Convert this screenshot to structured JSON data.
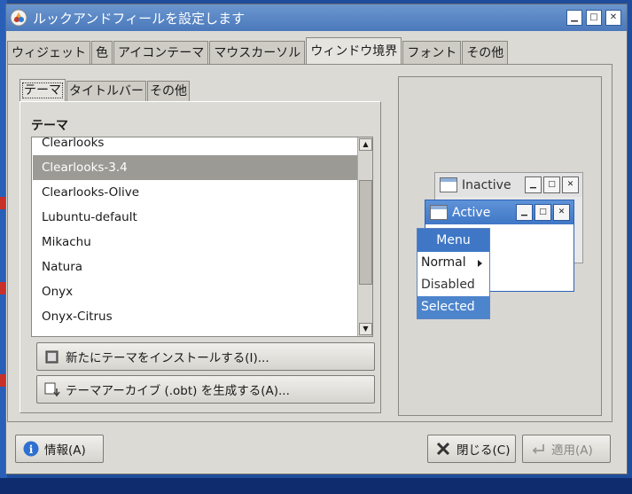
{
  "window": {
    "title": "ルックアンドフィールを設定します"
  },
  "tabs": [
    {
      "label": "ウィジェット"
    },
    {
      "label": "色"
    },
    {
      "label": "アイコンテーマ"
    },
    {
      "label": "マウスカーソル"
    },
    {
      "label": "ウィンドウ境界",
      "active": true
    },
    {
      "label": "フォント"
    },
    {
      "label": "その他"
    }
  ],
  "subtabs": [
    {
      "label": "テーマ",
      "active": true
    },
    {
      "label": "タイトルバー"
    },
    {
      "label": "その他"
    }
  ],
  "theme_section": {
    "label": "テーマ",
    "themes": [
      "Clearlooks",
      "Clearlooks-3.4",
      "Clearlooks-Olive",
      "Lubuntu-default",
      "Mikachu",
      "Natura",
      "Onyx",
      "Onyx-Citrus"
    ],
    "selected": "Clearlooks-3.4",
    "install_button": "新たにテーマをインストールする(I)...",
    "archive_button": "テーマアーカイブ (.obt) を生成する(A)..."
  },
  "preview": {
    "inactive_title": "Inactive",
    "active_title": "Active",
    "menu": {
      "title": "Menu",
      "items": [
        "Normal",
        "Disabled",
        "Selected"
      ]
    }
  },
  "footer": {
    "about_button": "情報(A)",
    "close_button": "閉じる(C)",
    "apply_button": "適用(A)"
  },
  "colors": {
    "titlebar": "#4a79bb",
    "selection": "#9c9a94",
    "preview_active": "#3f77c6"
  }
}
